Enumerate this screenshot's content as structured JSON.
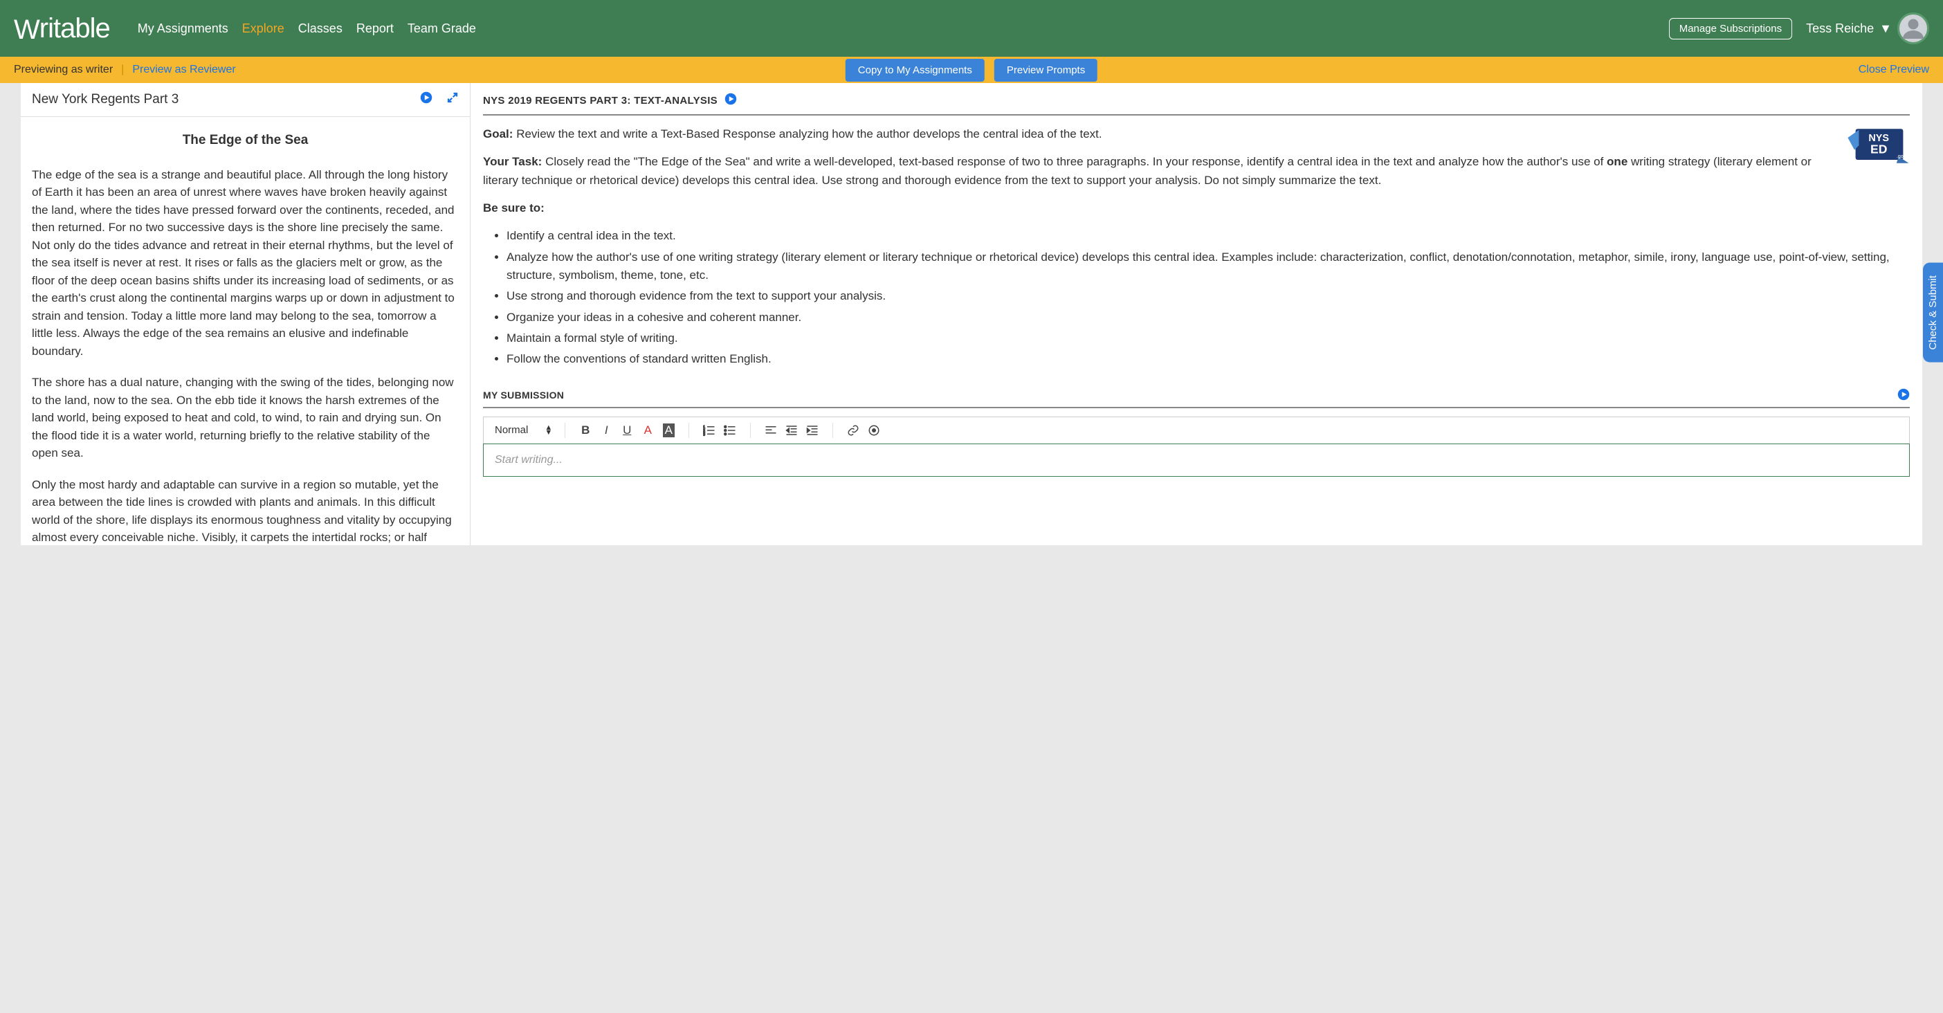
{
  "header": {
    "logo": "Writable",
    "nav": [
      "My Assignments",
      "Explore",
      "Classes",
      "Report",
      "Team Grade"
    ],
    "nav_active_index": 1,
    "manage_subs": "Manage Subscriptions",
    "user_name": "Tess Reiche"
  },
  "preview_bar": {
    "previewing": "Previewing as writer",
    "reviewer_link": "Preview as Reviewer",
    "copy_btn": "Copy to My Assignments",
    "preview_prompts_btn": "Preview Prompts",
    "close": "Close Preview"
  },
  "left": {
    "doc_title": "New York Regents Part 3",
    "article_title": "The Edge of the Sea",
    "paragraphs": [
      "The edge of the sea is a strange and beautiful place. All through the long history of Earth it has been an area of unrest where waves have broken heavily against the land, where the tides have pressed forward over the continents, receded, and then returned. For no two successive days is the shore line precisely the same. Not only do the tides advance and retreat in their eternal rhythms, but the level of the sea itself is never at rest. It rises or falls as the glaciers melt or grow, as the floor of the deep ocean basins shifts under its increasing load of sediments, or as the earth's crust along the continental margins warps up or down in adjustment to strain and tension. Today a little more land may belong to the sea, tomorrow a little less. Always the edge of the sea remains an elusive and indefinable boundary.",
      "The shore has a dual nature, changing with the swing of the tides, belonging now to the land, now to the sea. On the ebb tide it knows the harsh extremes of the land world, being exposed to heat and cold, to wind, to rain and drying sun. On the flood tide it is a water world, returning briefly to the relative stability of the open sea.",
      "Only the most hardy and adaptable can survive in a region so mutable, yet the area between the tide lines is crowded with plants and animals. In this difficult world of the shore, life displays its enormous toughness and vitality by occupying almost every conceivable niche. Visibly, it carpets the intertidal rocks; or half hidden, it descends into fissures and crevices, or hides under boulders, or lurks in the wet gloom of sea caves. Invisibly, where the casual"
    ]
  },
  "right": {
    "task_title": "NYS 2019 REGENTS PART 3: TEXT-ANALYSIS",
    "goal_label": "Goal:",
    "goal_text": "Review the text and write a Text-Based Response analyzing how the author develops the central idea of the text.",
    "task_label": "Your Task:",
    "task_pre": "Closely read the \"The Edge of the Sea\" and write a well-developed, text-based response of two to three paragraphs. In your response, identify a central idea in the text and analyze how the author's use of ",
    "task_bold": "one",
    "task_post": " writing strategy (literary element or literary technique or rhetorical device) develops this central idea. Use strong and thorough evidence from the text to support your analysis. Do not simply summarize the text.",
    "besure_label": "Be sure to:",
    "bullets": [
      "Identify a central idea in the text.",
      "Analyze how the author's use of one writing strategy (literary element or literary technique or rhetorical device) develops this central idea. Examples include: characterization, conflict, denotation/connotation, metaphor, simile, irony, language use, point-of-view, setting, structure, symbolism, theme, tone, etc.",
      "Use strong and thorough evidence from the text to support your analysis.",
      "Organize your ideas in a cohesive and coherent manner.",
      "Maintain a formal style of writing.",
      "Follow the conventions of standard written English."
    ],
    "submission_label": "MY SUBMISSION",
    "editor": {
      "format": "Normal",
      "placeholder": "Start writing..."
    }
  },
  "side_tab": "Check & Submit",
  "badge": {
    "line1": "NYS",
    "line2": "ED",
    "gov": ".gov"
  }
}
